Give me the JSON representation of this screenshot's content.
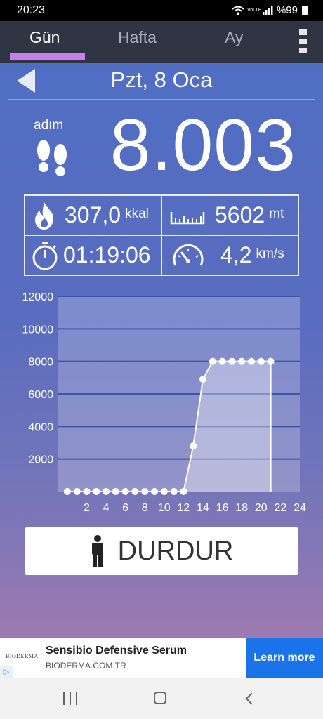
{
  "status_bar": {
    "time": "20:23",
    "network_badge": "VoLTE",
    "battery": "%99"
  },
  "tabs": [
    {
      "label": "Gün",
      "active": true
    },
    {
      "label": "Hafta",
      "active": false
    },
    {
      "label": "Ay",
      "active": false
    }
  ],
  "date_nav": {
    "date": "Pzt, 8 Oca"
  },
  "steps": {
    "label": "adım",
    "value": "8.003"
  },
  "stats": {
    "calories": {
      "value": "307,0",
      "unit": "kkal"
    },
    "distance": {
      "value": "5602",
      "unit": "mt"
    },
    "duration": {
      "value": "01:19:06"
    },
    "speed": {
      "value": "4,2",
      "unit": "km/s"
    }
  },
  "chart_data": {
    "type": "area",
    "title": "",
    "xlabel": "",
    "ylabel": "",
    "x_ticks": [
      "2",
      "4",
      "6",
      "8",
      "10",
      "12",
      "14",
      "16",
      "18",
      "20",
      "22",
      "24"
    ],
    "y_ticks": [
      "2000",
      "4000",
      "6000",
      "8000",
      "10000",
      "12000"
    ],
    "xlim": [
      -1,
      24
    ],
    "ylim": [
      0,
      12000
    ],
    "grid": true,
    "series": [
      {
        "x": [
          0,
          1,
          2,
          3,
          4,
          5,
          6,
          7,
          8,
          9,
          10,
          11,
          12,
          13,
          14,
          15,
          16,
          17,
          18,
          19,
          20,
          21
        ],
        "values": [
          0,
          0,
          0,
          0,
          0,
          0,
          0,
          0,
          0,
          0,
          0,
          0,
          0,
          2800,
          6900,
          8000,
          8000,
          8000,
          8000,
          8000,
          8000,
          8000
        ]
      }
    ]
  },
  "stop_button": {
    "label": "DURDUR"
  },
  "ad": {
    "logo": "BIODERMA",
    "title": "Sensibio Defensive Serum",
    "url": "BIODERMA.COM.TR",
    "cta": "Learn more"
  }
}
